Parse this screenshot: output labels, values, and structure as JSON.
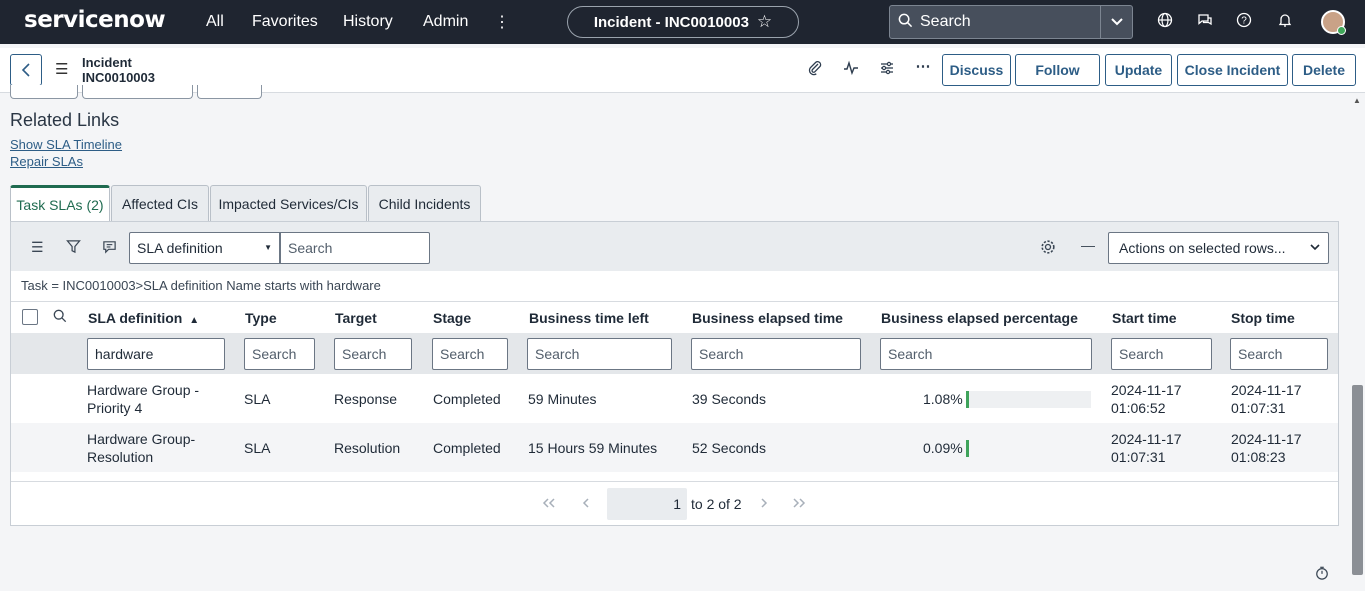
{
  "nav": {
    "logo": "servicenow",
    "links": [
      "All",
      "Favorites",
      "History",
      "Admin"
    ],
    "more_icon": "⋮",
    "record_pill": "Incident - INC0010003",
    "search_placeholder": "Search"
  },
  "header": {
    "type": "Incident",
    "number": "INC0010003",
    "buttons": {
      "discuss": "Discuss",
      "follow": "Follow",
      "update": "Update",
      "close_incident": "Close Incident",
      "delete": "Delete"
    }
  },
  "related_links": {
    "title": "Related Links",
    "links": [
      "Show SLA Timeline",
      "Repair SLAs"
    ]
  },
  "tabs": [
    "Task SLAs (2)",
    "Affected CIs",
    "Impacted Services/CIs",
    "Child Incidents"
  ],
  "list": {
    "filter_field": "SLA definition",
    "search_placeholder": "Search",
    "actions_label": "Actions on selected rows...",
    "breadcrumb": "Task = INC0010003>SLA definition Name starts with hardware",
    "columns": [
      "SLA definition",
      "Type",
      "Target",
      "Stage",
      "Business time left",
      "Business elapsed time",
      "Business elapsed percentage",
      "Start time",
      "Stop time"
    ],
    "sort_indicator": "▲",
    "filters": [
      "hardware",
      "Search",
      "Search",
      "Search",
      "Search",
      "Search",
      "Search",
      "Search",
      "Search"
    ],
    "rows": [
      {
        "sla_line1": "Hardware Group -",
        "sla_line2": "Priority 4",
        "type": "SLA",
        "target": "Response",
        "stage": "Completed",
        "time_left": "59 Minutes",
        "elapsed": "39 Seconds",
        "percentage": "1.08%",
        "percentage_value": 1.08,
        "start_date": "2024-11-17",
        "start_time": "01:06:52",
        "stop_date": "2024-11-17",
        "stop_time": "01:07:31"
      },
      {
        "sla_line1": "Hardware Group-",
        "sla_line2": "Resolution",
        "type": "SLA",
        "target": "Resolution",
        "stage": "Completed",
        "time_left": "15 Hours 59 Minutes",
        "elapsed": "52 Seconds",
        "percentage": "0.09%",
        "percentage_value": 0.09,
        "start_date": "2024-11-17",
        "start_time": "01:07:31",
        "stop_date": "2024-11-17",
        "stop_time": "01:08:23"
      }
    ],
    "pager": {
      "current": "1",
      "range": "to 2 of 2"
    }
  },
  "colors": {
    "nav_bg": "#1f2530",
    "primary": "#2d5d86",
    "active_tab": "#1f6b50",
    "progress": "#3fa35b"
  }
}
